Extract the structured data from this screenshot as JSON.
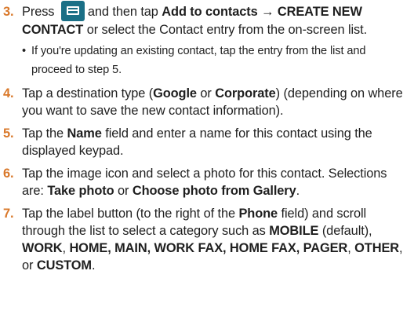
{
  "steps": [
    {
      "num": "3.",
      "parts": [
        "Press",
        "and then tap",
        "Add to contacts",
        "→",
        "CREATE NEW CONTACT",
        "or select the Contact entry from the on-screen list."
      ],
      "sub_bullet": "•",
      "sub": "If you're updating an existing contact, tap the entry from the list and proceed to step 5."
    },
    {
      "num": "4.",
      "parts": [
        "Tap a destination type (",
        "Google",
        "or",
        "Corporate",
        ") (depending on where you want to save the new contact information)."
      ]
    },
    {
      "num": "5.",
      "parts": [
        "Tap the",
        "Name",
        "field and enter a name for this contact using the displayed keypad."
      ]
    },
    {
      "num": "6.",
      "parts": [
        "Tap the image icon and select a photo for this contact. Selections are:",
        "Take photo",
        "or",
        "Choose photo from Gallery",
        "."
      ]
    },
    {
      "num": "7.",
      "parts": [
        "Tap the label button (to the right of the",
        "Phone",
        "field) and scroll through the list to select a category such as",
        "MOBILE",
        "(default),",
        "WORK",
        ",",
        "HOME, MAIN, WORK FAX, HOME FAX, PAGER",
        ",",
        "OTHER",
        ", or",
        "CUSTOM",
        "."
      ]
    }
  ],
  "icons": {
    "menu_key": "menu-key-icon"
  },
  "colors": {
    "step_number": "#d9782a",
    "menu_key_bg": "#1a6f86"
  }
}
